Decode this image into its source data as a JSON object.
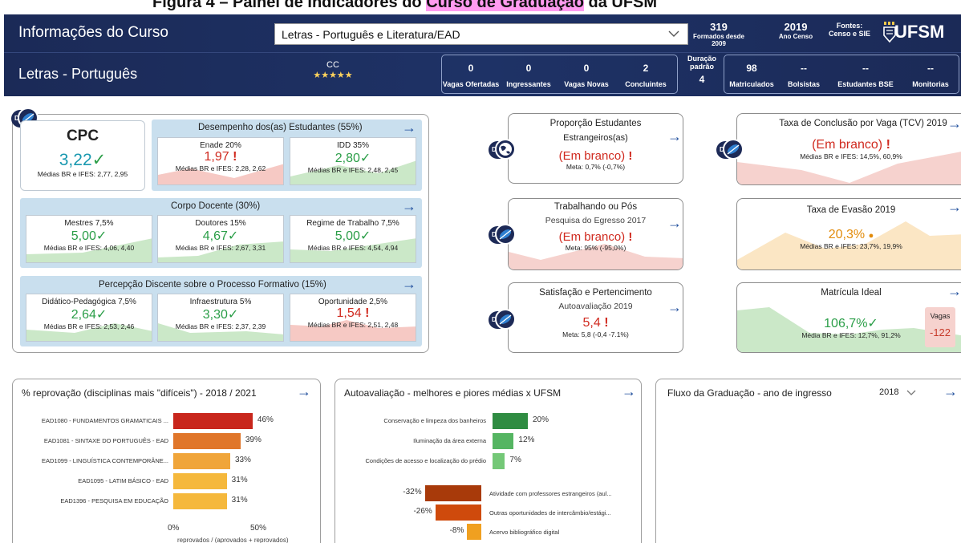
{
  "caption": {
    "pre": "Figura 4 – Painel de Indicadores do ",
    "highlight": "Curso de Graduação",
    "post": " da UFSM"
  },
  "header": {
    "title": "Informações do Curso",
    "course_select": "Letras - Português e Literatura/EAD",
    "formados": {
      "value": "319",
      "label": "Formados desde 2009"
    },
    "ano_censo": {
      "value": "2019",
      "label": "Ano Censo"
    },
    "fontes": {
      "value": "Fontes:",
      "label": "Censo e SIE"
    },
    "brand": "UFSM",
    "subtitle": "Letras - Português",
    "cc": {
      "label": "CC",
      "stars": "★★★★★"
    },
    "box1": [
      {
        "value": "0",
        "label": "Vagas Ofertadas"
      },
      {
        "value": "0",
        "label": "Ingressantes"
      },
      {
        "value": "0",
        "label": "Vagas Novas"
      },
      {
        "value": "2",
        "label": "Concluintes"
      }
    ],
    "duracao": {
      "label1": "Duração",
      "label2": "padrão",
      "value": "4"
    },
    "box2": [
      {
        "value": "98",
        "label": "Matriculados"
      },
      {
        "value": "--",
        "label": "Bolsistas"
      },
      {
        "value": "--",
        "label": "Estudantes BSE"
      },
      {
        "value": "--",
        "label": "Monitorias"
      }
    ]
  },
  "cpc": {
    "badge": "D2",
    "title": "CPC",
    "value": "3,22",
    "medias": "Médias BR e IFES: 2,77, 2,95",
    "desempenho": {
      "title": "Desempenho dos(as) Estudantes (55%)",
      "items": [
        {
          "t": "Enade 20%",
          "v": "1,97",
          "s": "Médias BR e IFES: 2,28, 2,62"
        },
        {
          "t": "IDD 35%",
          "v": "2,80",
          "s": "Médias BR e IFES: 2,48, 2,45"
        }
      ]
    },
    "docente": {
      "title": "Corpo Docente (30%)",
      "items": [
        {
          "t": "Mestres 7,5%",
          "v": "5,00",
          "s": "Médias BR e IFES: 4,06, 4,40"
        },
        {
          "t": "Doutores 15%",
          "v": "4,67",
          "s": "Médias BR e IFES: 2,67, 3,31"
        },
        {
          "t": "Regime de Trabalho 7,5%",
          "v": "5,00",
          "s": "Médias BR e IFES: 4,54, 4,94"
        }
      ]
    },
    "percepcao": {
      "title": "Percepção Discente sobre o Processo Formativo (15%)",
      "items": [
        {
          "t": "Didático-Pedagógica 7,5%",
          "v": "2,64",
          "s": "Médias BR e IFES: 2,53, 2,46"
        },
        {
          "t": "Infraestrutura 5%",
          "v": "3,30",
          "s": "Médias BR e IFES: 2,37, 2,39"
        },
        {
          "t": "Oportunidade 2,5%",
          "v": "1,54",
          "s": "Médias BR e IFES: 2,51, 2,48"
        }
      ]
    }
  },
  "middle": {
    "estrangeiros": {
      "badge": "D5",
      "t": "Proporção Estudantes",
      "s": "Estrangeiros(as)",
      "v": "(Em branco)",
      "m": "Meta: 0,7% (-0,7%)"
    },
    "trabalhando": {
      "badge": "D2",
      "t": "Trabalhando ou Pós",
      "s": "Pesquisa do Egresso 2017",
      "v": "(Em branco)",
      "m": "Meta: 95% (-95,0%)"
    },
    "satisfacao": {
      "badge": "D2",
      "t": "Satisfação e Pertencimento",
      "s": "Autoavaliação 2019",
      "v": "5,4",
      "m": "Meta: 5,8 (-0,4 -7.1%)"
    }
  },
  "right": {
    "tcv": {
      "badge": "D2",
      "t": "Taxa de Conclusão por Vaga (TCV) 2019",
      "v": "(Em branco)",
      "m": "Médias BR e IFES: 14,5%, 60,9%"
    },
    "evasao": {
      "t": "Taxa de Evasão 2019",
      "v": "20,3%",
      "m": "Médias BR e IFES: 23,7%, 19,9%"
    },
    "ideal": {
      "t": "Matrícula Ideal",
      "v": "106,7%",
      "m": "Média BR e IFES: 12,7%, 91,2%",
      "vagas_label": "Vagas",
      "vagas_value": "-122"
    }
  },
  "reprovacao": {
    "title": "% reprovação (disciplinas mais \"difíceis\") - 2018 / 2021",
    "axis_0": "0%",
    "axis_50": "50%",
    "axis_label": "reprovados / (aprovados + reprovados)"
  },
  "autoavaliacao": {
    "title": "Autoavaliação - melhores e piores médias x UFSM"
  },
  "fluxo": {
    "title": "Fluxo da Graduação - ano de ingresso",
    "year": "2018"
  },
  "chart_data": [
    {
      "type": "bar",
      "title": "% reprovação (disciplinas mais \"difíceis\") - 2018 / 2021",
      "xlabel": "reprovados / (aprovados + reprovados)",
      "categories": [
        "EAD1080 - FUNDAMENTOS GRAMATICAIS ...",
        "EAD1081 - SINTAXE DO PORTUGUÊS - EAD",
        "EAD1099 - LINGUÍSTICA CONTEMPORÂNE...",
        "EAD1095 - LATIM BÁSICO - EAD",
        "EAD1396 - PESQUISA EM EDUCAÇÃO"
      ],
      "values": [
        46,
        39,
        33,
        31,
        31
      ],
      "value_labels": [
        "46%",
        "39%",
        "33%",
        "31%",
        "31%"
      ],
      "colors": [
        "#c8261c",
        "#e0762a",
        "#f0a53a",
        "#f5b83c",
        "#f5b83c"
      ],
      "xlim": [
        0,
        50
      ]
    },
    {
      "type": "bar",
      "title": "Autoavaliação - melhores e piores médias x UFSM",
      "best": {
        "categories": [
          "Conservação e limpeza dos banheiros",
          "Iluminação da área externa",
          "Condições de acesso e localização do prédio"
        ],
        "values": [
          20,
          12,
          7
        ],
        "value_labels": [
          "20%",
          "12%",
          "7%"
        ],
        "colors": [
          "#2f8c42",
          "#55b562",
          "#74c877"
        ]
      },
      "worst": {
        "categories": [
          "Atividade com professores estrangeiros (aul...",
          "Outras oportunidades de intercâmbio/estági...",
          "Acervo bibliográfico digital"
        ],
        "values": [
          -32,
          -26,
          -8
        ],
        "value_labels": [
          "-32%",
          "-26%",
          "-8%"
        ],
        "colors": [
          "#a83a0a",
          "#cf4a0c",
          "#f0a020"
        ]
      }
    }
  ]
}
